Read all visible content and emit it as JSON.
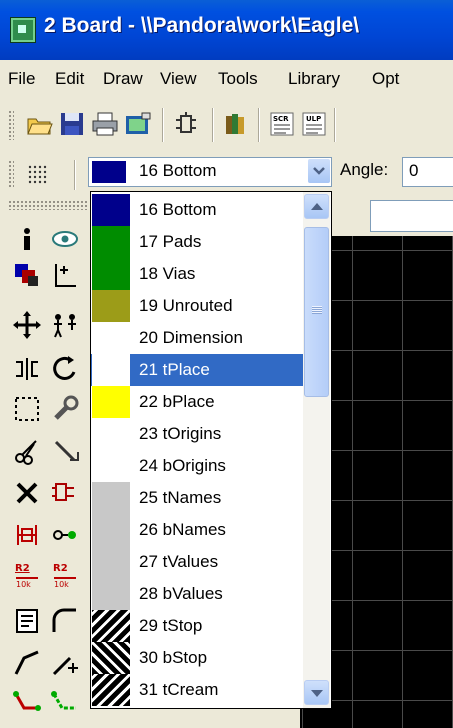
{
  "window": {
    "title": "2 Board - \\\\Pandora\\work\\Eagle\\"
  },
  "menu": [
    "File",
    "Edit",
    "Draw",
    "View",
    "Tools",
    "Library",
    "Opt"
  ],
  "layer_select": {
    "value": "16 Bottom",
    "swatch_color": "#00008b"
  },
  "angle": {
    "label": "Angle:",
    "value": "0"
  },
  "layers": [
    {
      "label": "16 Bottom",
      "color": "#00008b",
      "selected": false
    },
    {
      "label": "17 Pads",
      "color": "#008c00",
      "selected": false
    },
    {
      "label": "18 Vias",
      "color": "#008c00",
      "selected": false
    },
    {
      "label": "19 Unrouted",
      "color": "#9c9c18",
      "selected": false
    },
    {
      "label": "20 Dimension",
      "color": "#ffffff",
      "selected": false
    },
    {
      "label": "21 tPlace",
      "color": "#ffffff",
      "selected": true
    },
    {
      "label": "22 bPlace",
      "color": "#ffff00",
      "selected": false
    },
    {
      "label": "23 tOrigins",
      "color": "#ffffff",
      "selected": false
    },
    {
      "label": "24 bOrigins",
      "color": "#ffffff",
      "selected": false
    },
    {
      "label": "25 tNames",
      "color": "#c8c8c8",
      "selected": false
    },
    {
      "label": "26 bNames",
      "color": "#c8c8c8",
      "selected": false
    },
    {
      "label": "27 tValues",
      "color": "#c8c8c8",
      "selected": false
    },
    {
      "label": "28 bValues",
      "color": "#c8c8c8",
      "selected": false
    },
    {
      "label": "29 tStop",
      "color": "hatch",
      "selected": false
    },
    {
      "label": "30 bStop",
      "color": "hatch",
      "selected": false
    },
    {
      "label": "31 tCream",
      "color": "hatch",
      "selected": false
    }
  ],
  "colors": {
    "selection": "#316ac5",
    "canvas": "#000000",
    "titlebar": "#0046d5"
  },
  "icons": {
    "toolbar": [
      "open-icon",
      "save-icon",
      "print-icon",
      "cam-icon",
      "schematic-icon",
      "library-icon",
      "script-icon",
      "ulp-icon"
    ],
    "palette": [
      "info-icon",
      "show-icon",
      "display-icon",
      "mark-icon",
      "move-icon",
      "copy-icon",
      "mirror-icon",
      "rotate-icon",
      "group-icon",
      "change-icon",
      "cut-icon",
      "paste-icon",
      "delete-icon",
      "add-icon",
      "replace-icon",
      "pinswap-icon",
      "name-icon",
      "value-icon",
      "smash-icon",
      "miter-icon",
      "split-icon",
      "optimize-icon",
      "route-icon",
      "ripup-icon"
    ]
  },
  "r2_label": "R2",
  "r2_value": "10k"
}
